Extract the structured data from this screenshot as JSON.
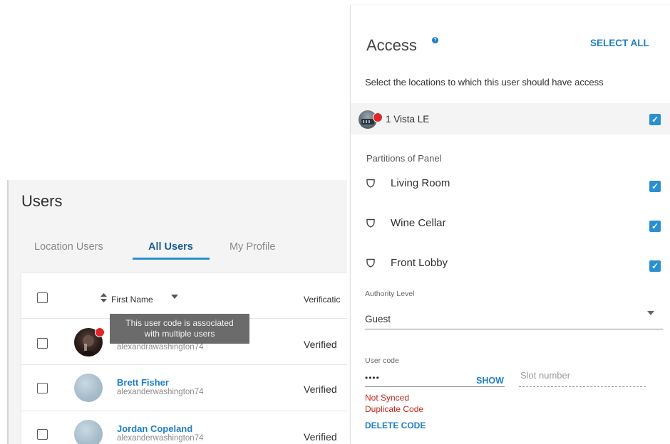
{
  "users": {
    "title": "Users",
    "tabs": [
      {
        "label": "Location Users",
        "active": false
      },
      {
        "label": "All Users",
        "active": true
      },
      {
        "label": "My Profile",
        "active": false
      }
    ],
    "table": {
      "col_first_name": "First Name",
      "col_verification": "Verificatic",
      "rows": [
        {
          "name": "",
          "username": "alexandrawashington74",
          "verification": "Verified"
        },
        {
          "name": "Brett Fisher",
          "username": "alexanderwashington74",
          "verification": "Verified"
        },
        {
          "name": "Jordan Copeland",
          "username": "alexanderwashington74",
          "verification": "Verified"
        }
      ]
    },
    "tooltip": {
      "line1": "This user code is associated",
      "line2": "with multiple users"
    }
  },
  "access": {
    "title": "Access",
    "help_icon": "?",
    "select_all": "SELECT ALL",
    "description": "Select the locations to which this user should have access",
    "location": {
      "name": "1 Vista LE",
      "checked": true
    },
    "partitions_label": "Partitions of Panel",
    "partitions": [
      {
        "name": "Living Room",
        "checked": true
      },
      {
        "name": "Wine Cellar",
        "checked": true
      },
      {
        "name": "Front Lobby",
        "checked": true
      }
    ],
    "authority": {
      "label": "Authority Level",
      "value": "Guest"
    },
    "user_code": {
      "label": "User code",
      "value": "••••",
      "show_label": "SHOW"
    },
    "slot_number": {
      "placeholder": "Slot number"
    },
    "status": [
      "Not Synced",
      "Duplicate Code"
    ],
    "delete_code": "DELETE CODE"
  },
  "colors": {
    "accent": "#1f7fc4",
    "checkbox": "#2a8fd1",
    "error": "#c4261d",
    "badge": "#e0262a"
  },
  "icons": {
    "sort": "sort-icon",
    "dropdown": "caret-down-icon",
    "shield": "shield-icon",
    "help": "help-icon",
    "check": "checkmark-icon"
  }
}
